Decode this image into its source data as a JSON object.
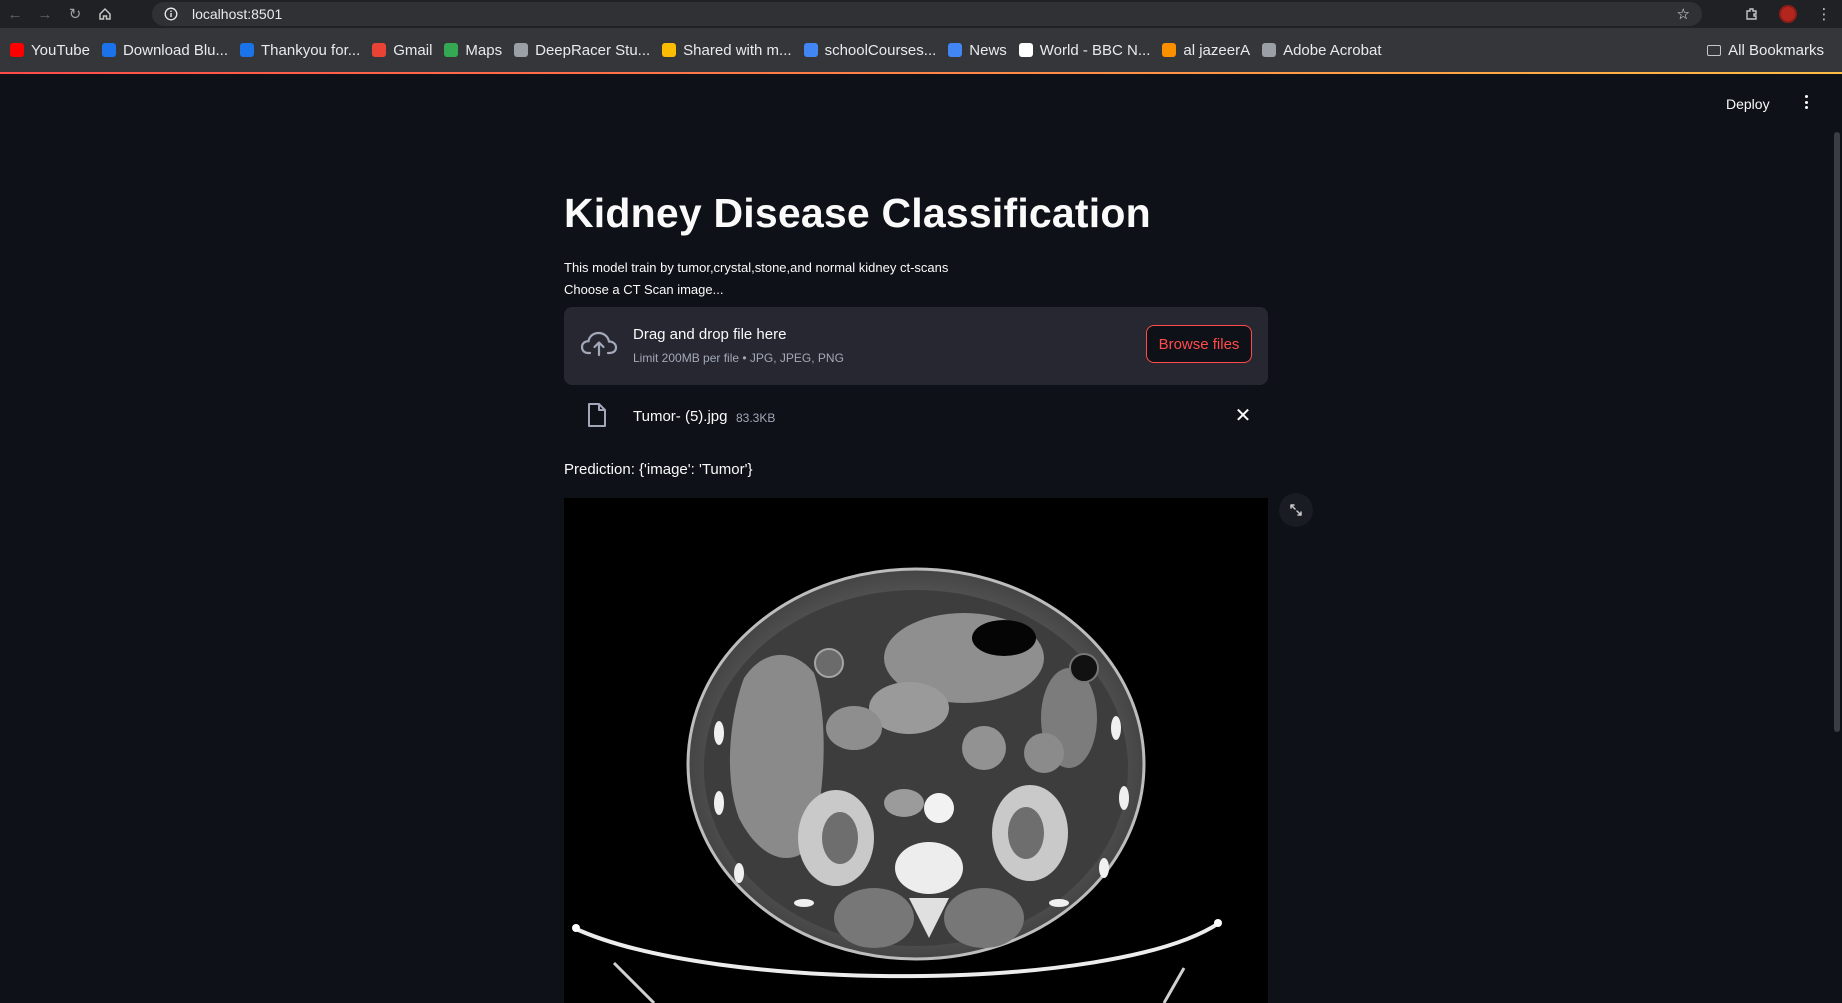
{
  "browser": {
    "url": "localhost:8501",
    "bookmarks": [
      {
        "label": "YouTube",
        "color": "#ff0000"
      },
      {
        "label": "Download Blu...",
        "color": "#1a73e8"
      },
      {
        "label": "Thankyou for...",
        "color": "#1a73e8"
      },
      {
        "label": "Gmail",
        "color": "#ea4335"
      },
      {
        "label": "Maps",
        "color": "#34a853"
      },
      {
        "label": "DeepRacer Stu...",
        "color": "#9aa0a6"
      },
      {
        "label": "Shared with m...",
        "color": "#fbbc04"
      },
      {
        "label": "schoolCourses...",
        "color": "#4285f4"
      },
      {
        "label": "News",
        "color": "#4285f4"
      },
      {
        "label": "World - BBC N...",
        "color": "#ffffff"
      },
      {
        "label": "al jazeerA",
        "color": "#fa9000"
      },
      {
        "label": "Adobe Acrobat",
        "color": "#9aa0a6"
      }
    ],
    "all_bookmarks": "All Bookmarks"
  },
  "header": {
    "deploy_label": "Deploy"
  },
  "main": {
    "title": "Kidney Disease Classification",
    "description": "This model train by tumor,crystal,stone,and normal kidney ct-scans",
    "uploader_label": "Choose a CT Scan image...",
    "dropzone": {
      "title": "Drag and drop file here",
      "subtitle": "Limit 200MB per file • JPG, JPEG, PNG",
      "browse_label": "Browse files"
    },
    "uploaded_file": {
      "name": "Tumor- (5).jpg",
      "size": "83.3KB"
    },
    "prediction": "Prediction: {'image': 'Tumor'}"
  },
  "colors": {
    "accent": "#ff4b4b",
    "background": "#0e1117",
    "surface": "#262730"
  }
}
